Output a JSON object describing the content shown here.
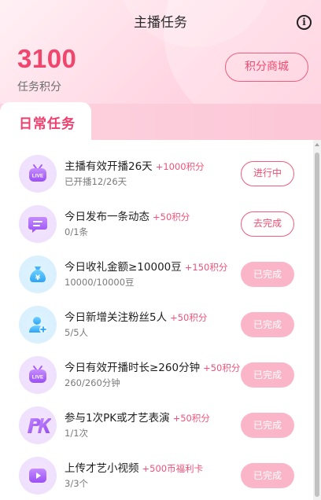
{
  "header": {
    "title": "主播任务",
    "info_icon": "info-circle-icon",
    "points_value": "3100",
    "points_label": "任务积分",
    "shop_button": "积分商城"
  },
  "tabs": [
    {
      "label": "日常任务",
      "active": true
    }
  ],
  "colors": {
    "accent": "#f0466e",
    "reward": "#f0527a",
    "done_button": "#fbb5c8"
  },
  "tasks": [
    {
      "icon": "live-tv-icon",
      "title": "主播有效开播26天",
      "reward": "+1000积分",
      "progress": "已开播12/26天",
      "action": "进行中",
      "state": "in-progress"
    },
    {
      "icon": "chat-bubble-icon",
      "title": "今日发布一条动态",
      "reward": "+50积分",
      "progress": "0/1条",
      "action": "去完成",
      "state": "todo"
    },
    {
      "icon": "money-bag-icon",
      "title": "今日收礼金额≥10000豆",
      "reward": "+150积分",
      "progress": "10000/10000豆",
      "action": "已完成",
      "state": "done"
    },
    {
      "icon": "add-follower-icon",
      "title": "今日新增关注粉丝5人",
      "reward": "+50积分",
      "progress": "5/5人",
      "action": "已完成",
      "state": "done"
    },
    {
      "icon": "live-tv-icon",
      "title": "今日有效开播时长≥260分钟",
      "reward": "+50积分",
      "progress": "260/260分钟",
      "action": "已完成",
      "state": "done"
    },
    {
      "icon": "pk-icon",
      "title": "参与1次PK或才艺表演",
      "reward": "+50积分",
      "progress": "1/1次",
      "action": "已完成",
      "state": "done"
    },
    {
      "icon": "video-play-icon",
      "title": "上传才艺小视频",
      "reward": "+500币福利卡",
      "progress": "3/3个",
      "action": "已完成",
      "state": "done"
    }
  ]
}
